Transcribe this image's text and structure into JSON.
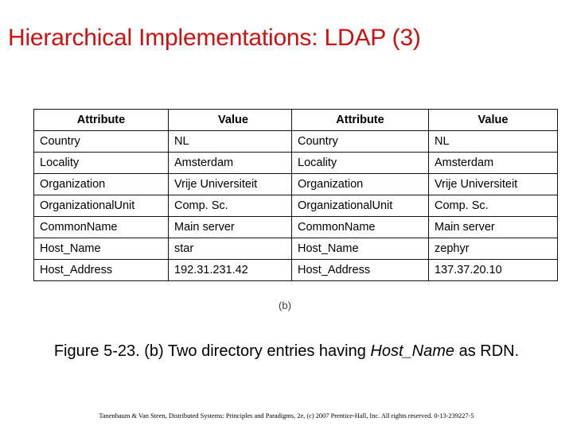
{
  "slide": {
    "title": "Hierarchical Implementations: LDAP (3)",
    "title_color": "#cc1111",
    "sub_label": "(b)"
  },
  "tables": {
    "columns": [
      "Attribute",
      "Value"
    ],
    "left": {
      "rows": [
        [
          "Country",
          "NL"
        ],
        [
          "Locality",
          "Amsterdam"
        ],
        [
          "Organization",
          "Vrije Universiteit"
        ],
        [
          "OrganizationalUnit",
          "Comp. Sc."
        ],
        [
          "CommonName",
          "Main server"
        ],
        [
          "Host_Name",
          "star"
        ],
        [
          "Host_Address",
          "192.31.231.42"
        ]
      ]
    },
    "right": {
      "rows": [
        [
          "Country",
          "NL"
        ],
        [
          "Locality",
          "Amsterdam"
        ],
        [
          "Organization",
          "Vrije Universiteit"
        ],
        [
          "OrganizationalUnit",
          "Comp. Sc."
        ],
        [
          "CommonName",
          "Main server"
        ],
        [
          "Host_Name",
          "zephyr"
        ],
        [
          "Host_Address",
          "137.37.20.10"
        ]
      ]
    }
  },
  "caption": {
    "part1": "Figure 5-23. (b) Two directory entries having ",
    "emphasis": "Host_Name",
    "part2": " as RDN."
  },
  "footer": {
    "credit": "Tanenbaum & Van Steen, Distributed Systems: Principles and Paradigms, 2e, (c) 2007 Prentice-Hall, Inc. All rights reserved. 0-13-239227-5"
  }
}
